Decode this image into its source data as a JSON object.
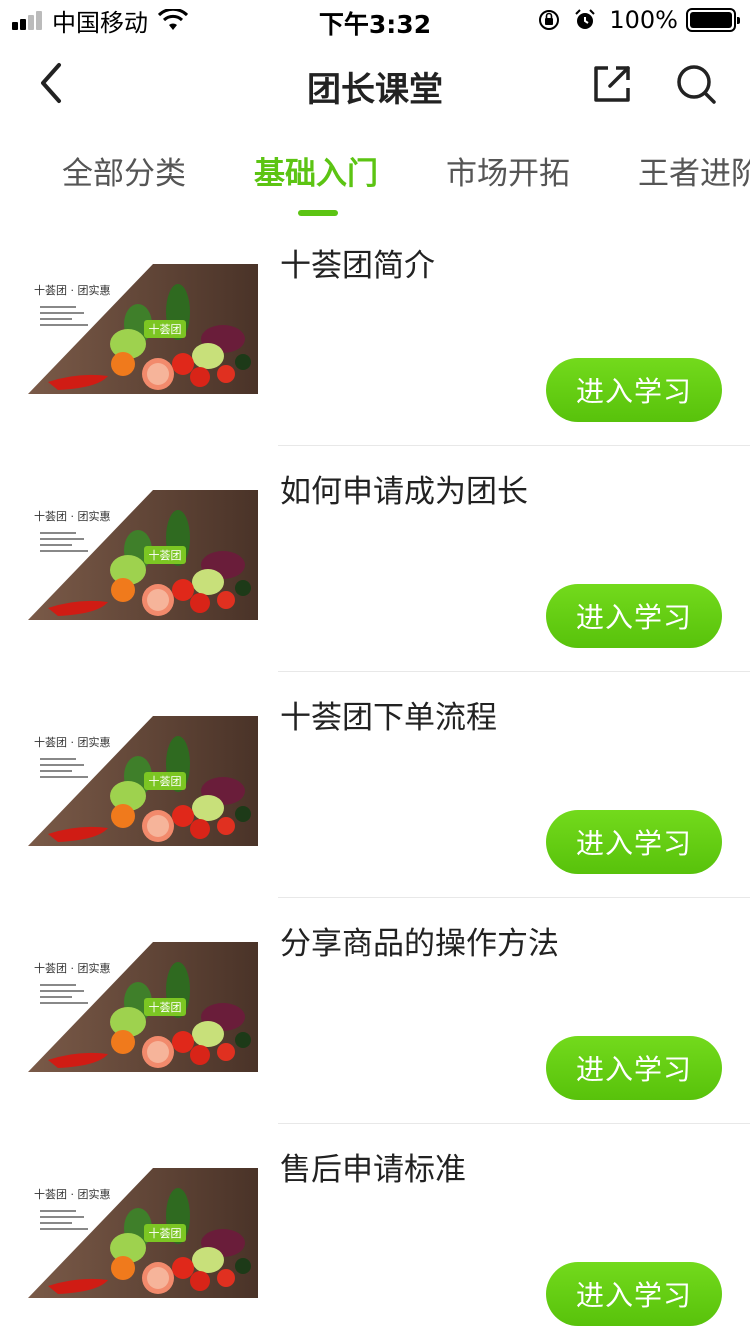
{
  "status_bar": {
    "carrier": "中国移动",
    "time": "下午3:32",
    "battery": "100%"
  },
  "nav": {
    "title": "团长课堂",
    "icons": [
      "back-arrow-icon",
      "share-icon",
      "search-icon"
    ]
  },
  "tabs": [
    {
      "label": "全部分类",
      "active": false
    },
    {
      "label": "基础入门",
      "active": true
    },
    {
      "label": "市场开拓",
      "active": false
    },
    {
      "label": "王者进阶",
      "active": false
    }
  ],
  "thumbnail": {
    "brand_text": "十荟团 · 团实惠",
    "badge_text": "十荟团"
  },
  "courses": [
    {
      "title": "十荟团简介",
      "button": "进入学习"
    },
    {
      "title": "如何申请成为团长",
      "button": "进入学习"
    },
    {
      "title": "十荟团下单流程",
      "button": "进入学习"
    },
    {
      "title": "分享商品的操作方法",
      "button": "进入学习"
    },
    {
      "title": "售后申请标准",
      "button": "进入学习"
    }
  ],
  "colors": {
    "accent": "#5cc413",
    "button_top": "#73da1c",
    "button_bottom": "#58c20b"
  }
}
